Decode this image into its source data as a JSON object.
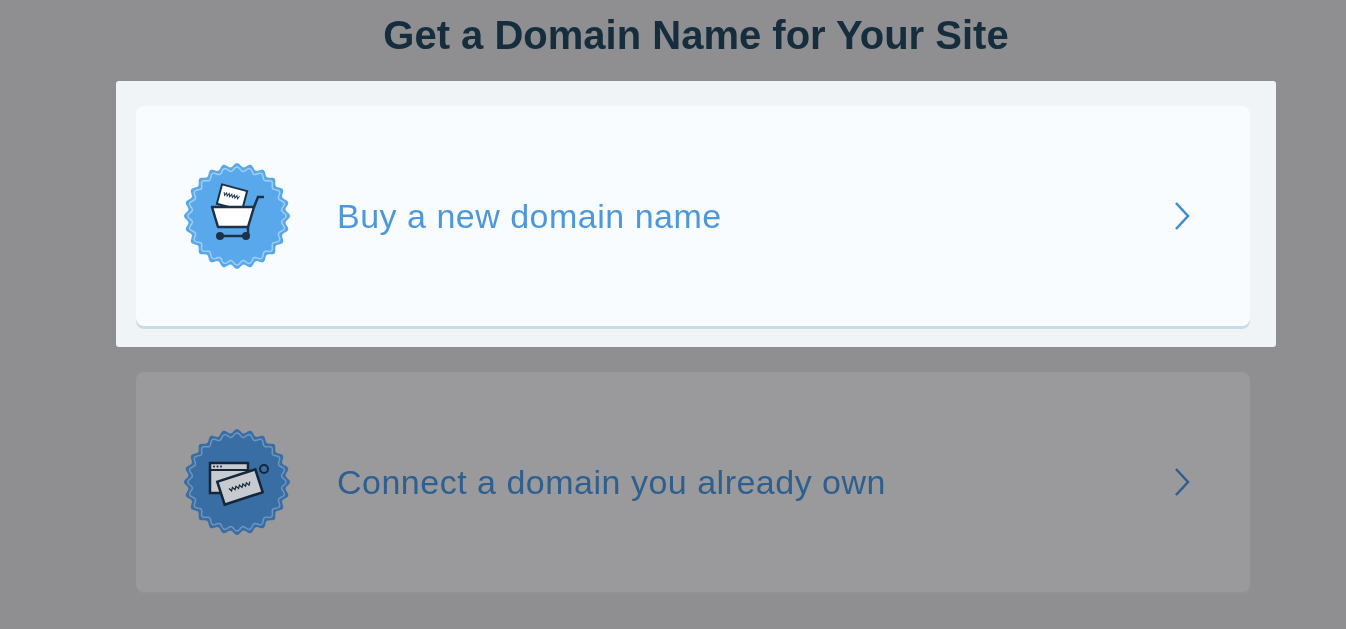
{
  "title": "Get a Domain Name for Your Site",
  "options": [
    {
      "kind": "buy",
      "label": "Buy a new domain name",
      "selected": true
    },
    {
      "kind": "connect",
      "label": "Connect a domain you already own",
      "selected": false
    }
  ]
}
